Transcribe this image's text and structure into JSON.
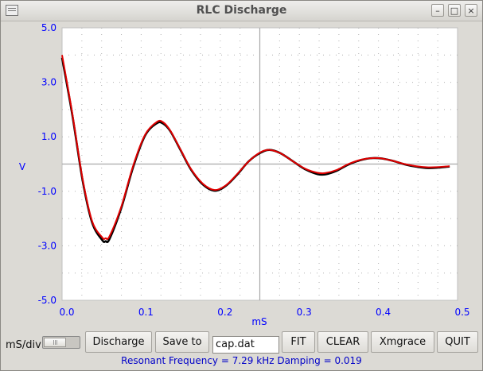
{
  "window": {
    "title": "RLC Discharge"
  },
  "plot": {
    "y_label": "V",
    "x_label": "mS",
    "y_ticks": [
      "5.0",
      "3.0",
      "1.0",
      "-1.0",
      "-3.0",
      "-5.0"
    ],
    "x_ticks": [
      "0.0",
      "0.1",
      "0.2",
      "0.3",
      "0.4",
      "0.5"
    ],
    "colors": {
      "axis_text": "#0000ff",
      "measured_trace": "#000000",
      "fit_trace": "#e00000",
      "grid": "#b0b0b0"
    }
  },
  "chart_data": {
    "type": "line",
    "xlabel": "mS",
    "ylabel": "V",
    "xlim": [
      0.0,
      0.5
    ],
    "ylim": [
      -5.0,
      5.0
    ],
    "x_ticks": [
      0.0,
      0.1,
      0.2,
      0.3,
      0.4,
      0.5
    ],
    "y_ticks": [
      5.0,
      3.0,
      1.0,
      -1.0,
      -3.0,
      -5.0
    ],
    "grid": true,
    "series": [
      {
        "color": "#000000",
        "x": [
          0.0,
          0.013,
          0.026,
          0.038,
          0.051,
          0.055,
          0.06,
          0.075,
          0.09,
          0.105,
          0.12,
          0.128,
          0.137,
          0.15,
          0.163,
          0.178,
          0.193,
          0.207,
          0.221,
          0.236,
          0.25,
          0.262,
          0.276,
          0.292,
          0.308,
          0.323,
          0.333,
          0.347,
          0.362,
          0.378,
          0.393,
          0.405,
          0.418,
          0.433,
          0.448,
          0.463,
          0.476,
          0.49
        ],
        "y": [
          3.9,
          1.8,
          -0.6,
          -2.15,
          -2.8,
          -2.83,
          -2.75,
          -1.6,
          -0.1,
          1.05,
          1.5,
          1.48,
          1.2,
          0.5,
          -0.2,
          -0.75,
          -0.98,
          -0.8,
          -0.4,
          0.1,
          0.4,
          0.52,
          0.4,
          0.1,
          -0.2,
          -0.37,
          -0.38,
          -0.25,
          -0.02,
          0.15,
          0.22,
          0.2,
          0.12,
          -0.01,
          -0.1,
          -0.15,
          -0.13,
          -0.09
        ]
      },
      {
        "color": "#e00000",
        "x": [
          0.0,
          0.013,
          0.026,
          0.038,
          0.051,
          0.055,
          0.06,
          0.075,
          0.09,
          0.105,
          0.12,
          0.128,
          0.137,
          0.15,
          0.163,
          0.178,
          0.193,
          0.207,
          0.221,
          0.236,
          0.25,
          0.262,
          0.276,
          0.292,
          0.308,
          0.323,
          0.333,
          0.347,
          0.362,
          0.378,
          0.393,
          0.405,
          0.418,
          0.433,
          0.448,
          0.463,
          0.476,
          0.49
        ],
        "y": [
          4.0,
          1.85,
          -0.55,
          -2.1,
          -2.7,
          -2.72,
          -2.65,
          -1.55,
          -0.05,
          1.08,
          1.55,
          1.53,
          1.22,
          0.52,
          -0.18,
          -0.72,
          -0.95,
          -0.78,
          -0.38,
          0.1,
          0.42,
          0.52,
          0.4,
          0.1,
          -0.18,
          -0.32,
          -0.33,
          -0.22,
          0.0,
          0.16,
          0.22,
          0.2,
          0.12,
          0.0,
          -0.08,
          -0.12,
          -0.11,
          -0.08
        ]
      }
    ]
  },
  "controls": {
    "ms_div_label": "mS/div",
    "discharge_label": "Discharge",
    "save_label": "Save to",
    "filename_value": "cap.dat",
    "fit_label": "FIT",
    "clear_label": "CLEAR",
    "xmgrace_label": "Xmgrace",
    "quit_label": "QUIT"
  },
  "status": {
    "text": "Resonant Frequency =  7.29 kHz Damping = 0.019"
  },
  "icons": {
    "window_menu": "window-menu-icon",
    "minimize": "minimize-icon",
    "maximize": "maximize-icon",
    "close": "close-icon"
  }
}
